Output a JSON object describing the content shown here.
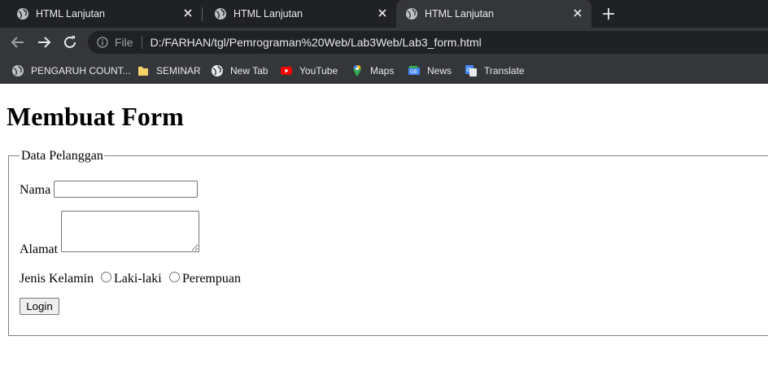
{
  "browser": {
    "tabs": [
      {
        "title": "HTML Lanjutan",
        "active": false
      },
      {
        "title": "HTML Lanjutan",
        "active": false
      },
      {
        "title": "HTML Lanjutan",
        "active": true
      }
    ],
    "address": {
      "scheme_label": "File",
      "url": "D:/FARHAN/tgl/Pemrograman%20Web/Lab3Web/Lab3_form.html"
    },
    "bookmarks": [
      {
        "label": "PENGARUH COUNT...",
        "icon": "globe-icon"
      },
      {
        "label": "SEMINAR",
        "icon": "folder-icon"
      },
      {
        "label": "New Tab",
        "icon": "globe-icon"
      },
      {
        "label": "YouTube",
        "icon": "youtube-icon"
      },
      {
        "label": "Maps",
        "icon": "maps-icon"
      },
      {
        "label": "News",
        "icon": "news-icon"
      },
      {
        "label": "Translate",
        "icon": "translate-icon"
      }
    ],
    "colors": {
      "frame": "#202124",
      "toolbar": "#35363a",
      "text": "#e8eaed"
    }
  },
  "page": {
    "heading": "Membuat Form",
    "fieldset_legend": "Data Pelanggan",
    "nama_label": "Nama",
    "nama_value": "",
    "alamat_label": "Alamat",
    "alamat_value": "",
    "gender_label": "Jenis Kelamin",
    "gender_options": [
      "Laki-laki",
      "Perempuan"
    ],
    "submit_label": "Login"
  }
}
